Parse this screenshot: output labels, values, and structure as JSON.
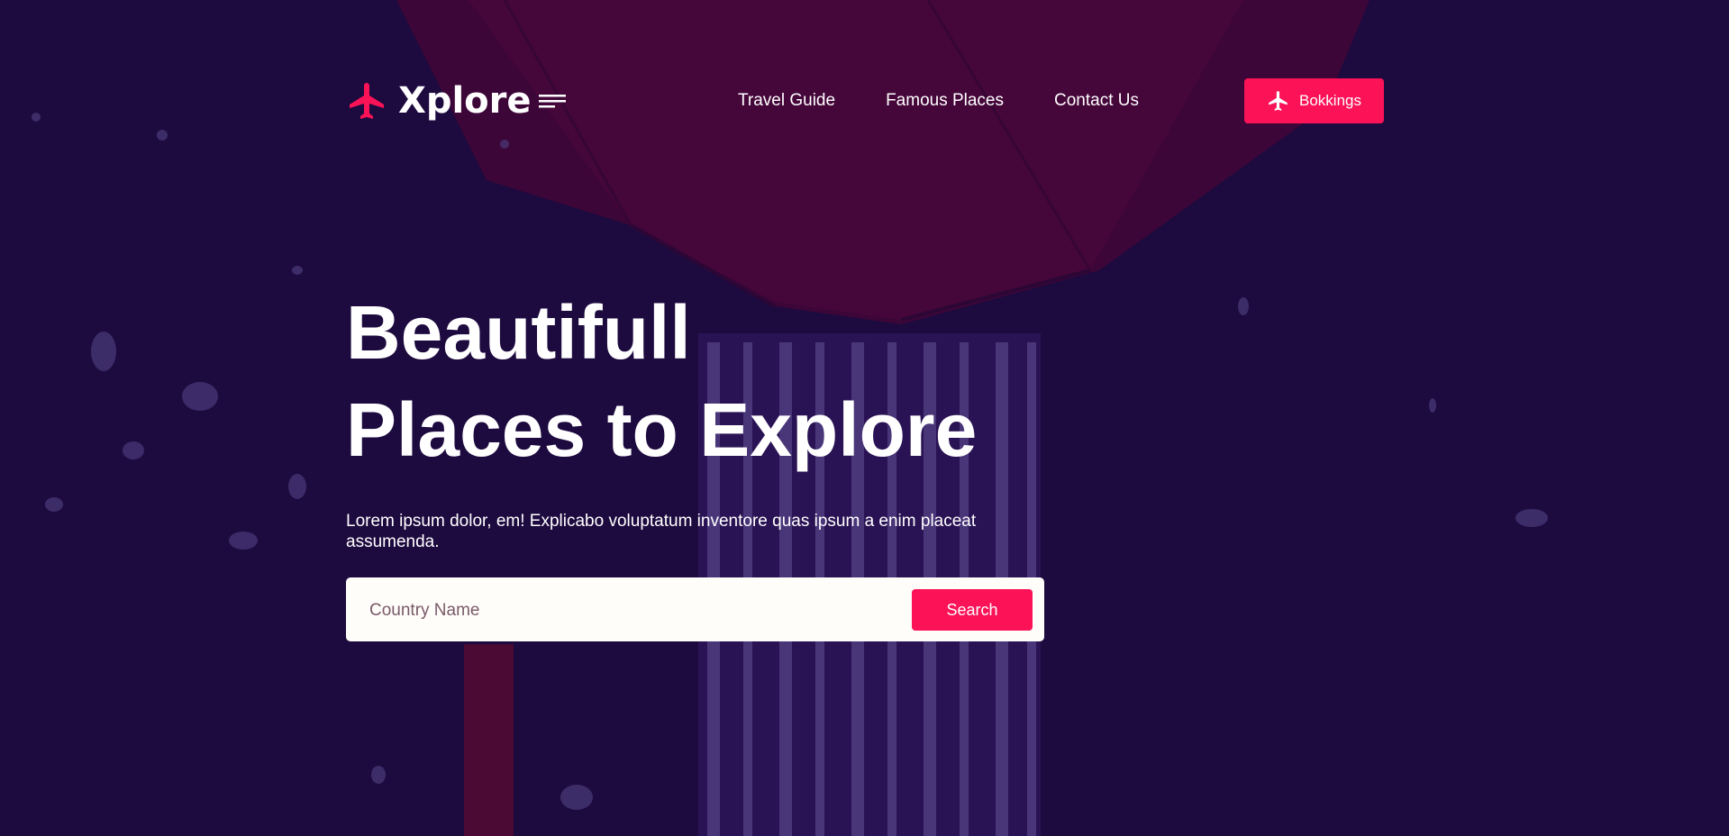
{
  "brand": {
    "name": "Xplore",
    "accent_color": "#fb1257",
    "background_color": "#1d0a3f"
  },
  "nav": {
    "items": [
      {
        "label": "Travel Guide"
      },
      {
        "label": "Famous Places"
      },
      {
        "label": "Contact Us"
      }
    ],
    "bookings_label": "Bokkings"
  },
  "hero": {
    "title_line1": "Beautifull",
    "title_line2": "Places to Explore",
    "description": "Lorem ipsum dolor, em! Explicabo voluptatum inventore quas ipsum a enim placeat assumenda."
  },
  "search": {
    "placeholder": "Country Name",
    "button_label": "Search"
  },
  "icons": {
    "logo": "airplane-icon",
    "menu": "menu-lines-icon",
    "bookings": "airplane-icon"
  }
}
